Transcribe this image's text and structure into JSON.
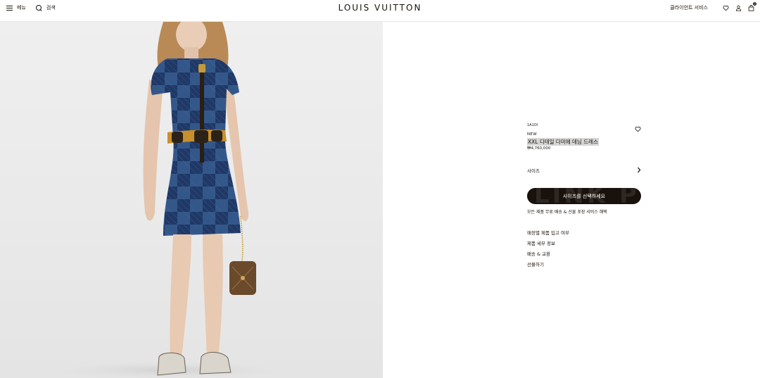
{
  "header": {
    "menu_label": "메뉴",
    "search_label": "검색",
    "brand": "LOUIS VUITTON",
    "client_service": "클라이언트 서비스",
    "cart_count": "0"
  },
  "product": {
    "sku": "1A1OI",
    "badge": "NEW",
    "name": "XXL 디테일 다미에 데님 드레스",
    "price": "₩4,760,000",
    "size_label": "사이즈",
    "select_button": "사이즈를 선택하세요",
    "benefit": "모든 제품 무료 배송 & 선물 포장 서비스 혜택"
  },
  "links": [
    {
      "label": "매장별 제품 입고 여부"
    },
    {
      "label": "제품 세부 정보"
    },
    {
      "label": "배송 & 교환"
    },
    {
      "label": "선물하기"
    }
  ],
  "colors": {
    "ink": "#19110b",
    "button_bg": "#19110b",
    "image_bg": "#ececec",
    "denim": "#3b5f93",
    "denim_dark": "#1f3866"
  },
  "icons": [
    "menu-icon",
    "search-icon",
    "heart-icon",
    "user-icon",
    "bag-icon",
    "chevron-right-icon"
  ]
}
